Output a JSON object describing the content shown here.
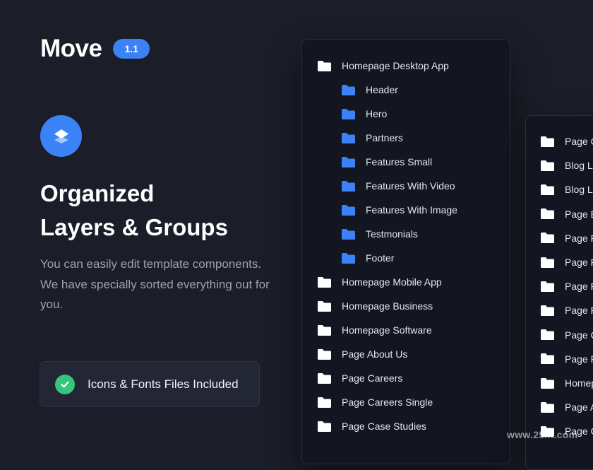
{
  "brand": {
    "title": "Move",
    "version": "1.1"
  },
  "headline": {
    "line1": "Organized",
    "line2": "Layers & Groups"
  },
  "description": "You can easily edit template components. We have specially sorted everything out for you.",
  "feature": {
    "label": "Icons & Fonts Files Included"
  },
  "layers_panel": {
    "items": [
      {
        "label": "Homepage Desktop App",
        "level": 0,
        "folder_color": "#ffffff"
      },
      {
        "label": "Header",
        "level": 1,
        "folder_color": "#3b82f6"
      },
      {
        "label": "Hero",
        "level": 1,
        "folder_color": "#3b82f6"
      },
      {
        "label": "Partners",
        "level": 1,
        "folder_color": "#3b82f6"
      },
      {
        "label": "Features Small",
        "level": 1,
        "folder_color": "#3b82f6"
      },
      {
        "label": "Features With Video",
        "level": 1,
        "folder_color": "#3b82f6"
      },
      {
        "label": "Features With Image",
        "level": 1,
        "folder_color": "#3b82f6"
      },
      {
        "label": "Testmonials",
        "level": 1,
        "folder_color": "#3b82f6"
      },
      {
        "label": "Footer",
        "level": 1,
        "folder_color": "#3b82f6"
      },
      {
        "label": "Homepage Mobile App",
        "level": 0,
        "folder_color": "#ffffff"
      },
      {
        "label": "Homepage Business",
        "level": 0,
        "folder_color": "#ffffff"
      },
      {
        "label": "Homepage Software",
        "level": 0,
        "folder_color": "#ffffff"
      },
      {
        "label": "Page About Us",
        "level": 0,
        "folder_color": "#ffffff"
      },
      {
        "label": "Page Careers",
        "level": 0,
        "folder_color": "#ffffff"
      },
      {
        "label": "Page Careers Single",
        "level": 0,
        "folder_color": "#ffffff"
      },
      {
        "label": "Page Case Studies",
        "level": 0,
        "folder_color": "#ffffff"
      }
    ]
  },
  "secondary_panel": {
    "items": [
      "Page C",
      "Blog Li",
      "Blog Li",
      "Page B",
      "Page P",
      "Page P",
      "Page P",
      "Page P",
      "Page C",
      "Page P",
      "Homep",
      "Page A",
      "Page C"
    ]
  },
  "watermark": "www.25xt.com",
  "colors": {
    "background": "#1b1d28",
    "accent": "#3b82f6",
    "success": "#34c77b",
    "panel": "#131520"
  }
}
